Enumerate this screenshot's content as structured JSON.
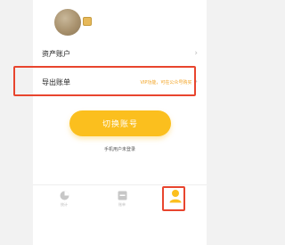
{
  "profile": {
    "avatar_icon": "user-avatar",
    "badge_icon": "gold-badge-icon"
  },
  "menu": {
    "assets_label": "资产账户",
    "export_label": "导出账单",
    "export_hint": "VIP功能，可在公众号购买"
  },
  "actions": {
    "switch_account_label": "切换账号",
    "login_note": "手机用户未登录"
  },
  "tabbar": {
    "items": [
      {
        "label": "统计",
        "icon": "pie-chart-icon",
        "active": false
      },
      {
        "label": "账单",
        "icon": "ledger-icon",
        "active": false
      },
      {
        "label": "",
        "icon": "person-icon",
        "active": true
      }
    ]
  },
  "colors": {
    "accent": "#fbbf1e",
    "hint": "#f2a11e",
    "highlight": "#e8452e",
    "inactive_icon": "#c7c7c7"
  }
}
